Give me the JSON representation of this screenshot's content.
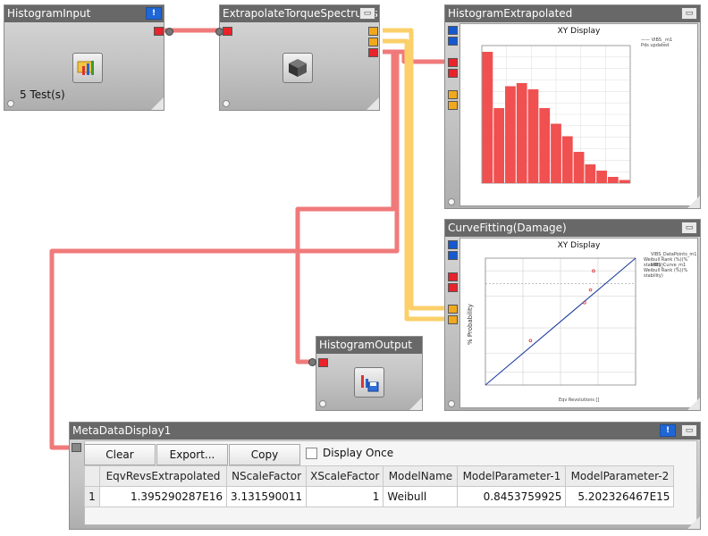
{
  "nodes": {
    "histogram_input": {
      "title": "HistogramInput",
      "label": "5 Test(s)"
    },
    "extrapolate": {
      "title": "ExtrapolateTorqueSpectrums"
    },
    "histogram_extrapolated": {
      "title": "HistogramExtrapolated"
    },
    "curve_fitting": {
      "title": "CurveFitting(Damage)"
    },
    "histogram_output": {
      "title": "HistogramOutput"
    },
    "metadata_display": {
      "title": "MetaDataDisplay1"
    }
  },
  "icons": {
    "info_button": "!",
    "window_button": "▭"
  },
  "colors": {
    "title_bar": "#686868",
    "red_port": "#e8232b",
    "orange_port": "#f0a81e",
    "blue_port": "#1559d0",
    "red_wire": "#f07a7a",
    "orange_wire": "#fbd06a",
    "bar_fill": "#f05050",
    "fit_line": "#1f3f9e"
  },
  "chart_hist": {
    "title": "XY Display",
    "legend": [
      "—— VIBS _m1",
      "Pds updated"
    ]
  },
  "chart_fit": {
    "title": "XY Display",
    "ylabel": "% Probability",
    "xlabel": "Eqv Revolutions []",
    "legend": [
      "VIBS_DataPoints_m1",
      "Weibull Rank (%)(% stability)",
      "VIBS_Curve_m1",
      "Weibull Rank (%)(% stability)"
    ]
  },
  "chart_data": [
    {
      "type": "bar",
      "title": "XY Display",
      "values": [
        2.1,
        1.2,
        1.55,
        1.6,
        1.5,
        1.2,
        0.95,
        0.75,
        0.5,
        0.3,
        0.2,
        0.1,
        0.05
      ],
      "ylim": [
        0,
        2.2
      ],
      "xlim": [
        0,
        300
      ],
      "grid": true,
      "legend_position": "top-right"
    },
    {
      "type": "scatter",
      "title": "XY Display",
      "ylabel": "% Probability",
      "xlabel": "Eqv Revolutions []",
      "points_x": [
        0.3,
        0.66,
        0.7,
        0.72
      ],
      "points_y": [
        0.35,
        0.65,
        0.75,
        0.9
      ],
      "line_x": [
        0.0,
        1.0
      ],
      "line_y": [
        0.0,
        1.0
      ],
      "grid": true,
      "legend_position": "top-right"
    }
  ],
  "meta": {
    "buttons": {
      "clear": "Clear",
      "export": "Export...",
      "copy": "Copy"
    },
    "checkbox_label": "Display Once",
    "columns": [
      "EqvRevsExtrapolated",
      "NScaleFactor",
      "XScaleFactor",
      "ModelName",
      "ModelParameter-1",
      "ModelParameter-2"
    ],
    "rows": [
      {
        "index": "1",
        "cells": [
          "1.395290287E16",
          "3.131590011",
          "1",
          "Weibull",
          "0.8453759925",
          "5.202326467E15"
        ]
      }
    ]
  }
}
